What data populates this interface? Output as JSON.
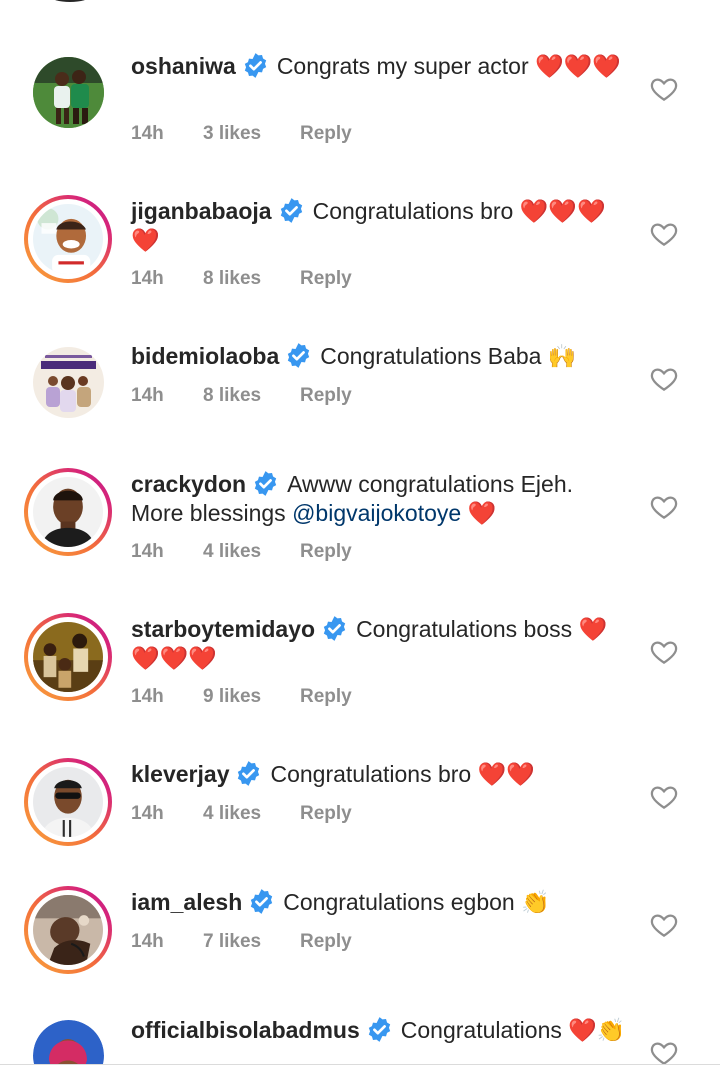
{
  "comments": [
    {
      "username": "oshaniwa",
      "text": "Congrats my super actor ❤️❤️❤️",
      "time": "14h",
      "likes": "3 likes",
      "reply": "Reply",
      "avatar": "soccer-players-photo",
      "story_ring": false
    },
    {
      "username": "jiganbabaoja",
      "text": "Congratulations bro ❤️❤️❤️❤️",
      "time": "14h",
      "likes": "8 likes",
      "reply": "Reply",
      "avatar": "cartoon-man-portrait",
      "story_ring": true
    },
    {
      "username": "bidemiolaoba",
      "text": "Congratulations Baba 🙌",
      "time": "14h",
      "likes": "8 likes",
      "reply": "Reply",
      "avatar": "movie-poster-akanchawa",
      "story_ring": false
    },
    {
      "username": "crackydon",
      "text_before": "Awww congratulations Ejeh. More blessings ",
      "mention": "@bigvaijokotoye",
      "text_after": " ❤️",
      "time": "14h",
      "likes": "4 likes",
      "reply": "Reply",
      "avatar": "man-portrait",
      "story_ring": true
    },
    {
      "username": "starboytemidayo",
      "text": "Congratulations boss ❤️❤️❤️❤️",
      "time": "14h",
      "likes": "9 likes",
      "reply": "Reply",
      "avatar": "group-photo",
      "story_ring": true
    },
    {
      "username": "kleverjay",
      "text": "Congratulations bro ❤️❤️",
      "time": "14h",
      "likes": "4 likes",
      "reply": "Reply",
      "avatar": "man-sunglasses",
      "story_ring": true
    },
    {
      "username": "iam_alesh",
      "text": "Congratulations egbon 👏",
      "time": "14h",
      "likes": "7 likes",
      "reply": "Reply",
      "avatar": "man-tattoo-photo",
      "story_ring": true
    },
    {
      "username": "officialbisolabadmus",
      "text": "Congratulations ❤️👏",
      "avatar": "woman-portrait",
      "story_ring": false
    }
  ],
  "colors": {
    "username": "#262626",
    "meta": "#8e8e8e",
    "mention": "#00376b",
    "verified": "#3897f0",
    "heart": "#ed1c24"
  }
}
